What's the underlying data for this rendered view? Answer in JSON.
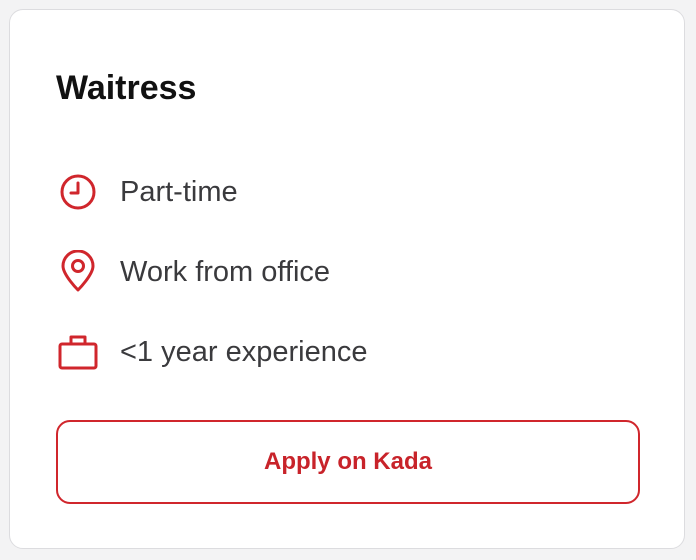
{
  "job": {
    "title": "Waitress",
    "details": [
      {
        "icon": "clock-icon",
        "text": "Part-time"
      },
      {
        "icon": "location-pin-icon",
        "text": "Work from office"
      },
      {
        "icon": "briefcase-icon",
        "text": "<1 year experience"
      }
    ],
    "apply_label": "Apply on Kada"
  },
  "colors": {
    "accent": "#d0262c",
    "text": "#3a3a3d",
    "title": "#111111",
    "border": "#dcdcdf"
  }
}
